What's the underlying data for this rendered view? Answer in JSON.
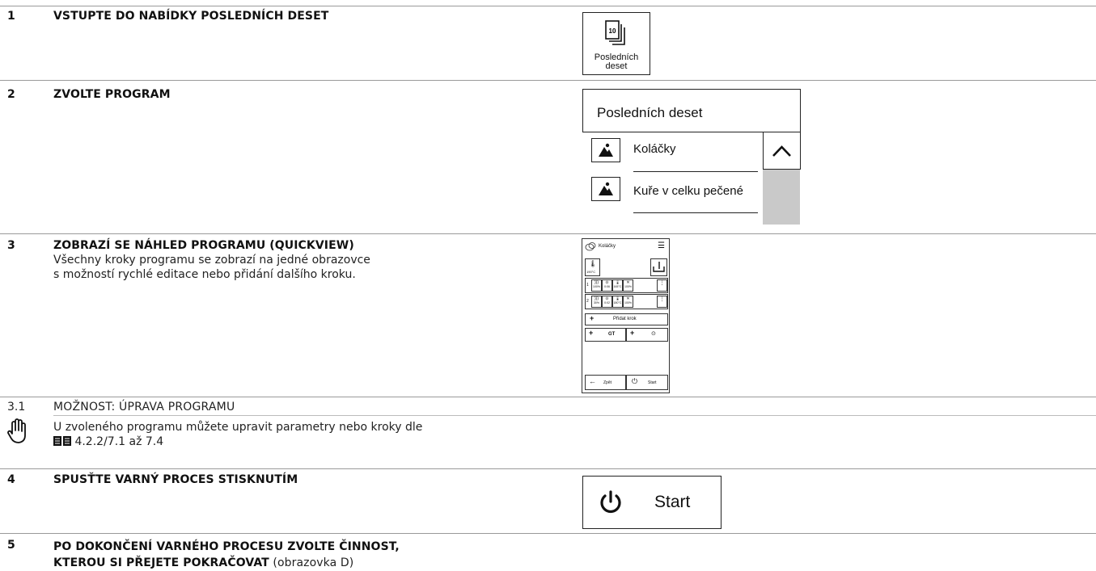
{
  "steps": [
    {
      "num": "1",
      "heading": "VSTUPTE DO NABÍDKY POSLEDNÍCH DESET"
    },
    {
      "num": "2",
      "heading": "ZVOLTE PROGRAM"
    },
    {
      "num": "3",
      "heading": "ZOBRAZÍ SE NÁHLED PROGRAMU (QUICKVIEW)",
      "text_line1": "Všechny kroky programu se zobrazí na jedné obrazovce",
      "text_line2": "s možností rychlé editace nebo přidání dalšího kroku."
    },
    {
      "num": "3.1",
      "heading": "MOŽNOST: ÚPRAVA PROGRAMU",
      "text_line1": "U zvoleného programu můžete upravit parametry nebo kroky dle",
      "ref": "4.2.2/7.1 až 7.4"
    },
    {
      "num": "4",
      "heading": "SPUSŤTE VARNÝ PROCES STISKNUTÍM"
    },
    {
      "num": "5",
      "heading_line1": "PO DOKONČENÍ VARNÉHO PROCESU ZVOLTE ČINNOST,",
      "heading_line2": "KTEROU SI PŘEJETE POKRAČOVAT",
      "suffix": " (obrazovka D)"
    }
  ],
  "last_ten_tile": {
    "icon_number": "10",
    "label_line1": "Posledních",
    "label_line2": "deset",
    "icon": "stacked-pages-icon"
  },
  "program_list": {
    "title": "Posledních deset",
    "items": [
      {
        "label": "Koláčky",
        "icon": "image-placeholder-icon"
      },
      {
        "label": "Kuře v celku pečené",
        "icon": "image-placeholder-icon"
      }
    ],
    "scroll_icon": "chevron-up-icon"
  },
  "quickview": {
    "title": "Koláčky",
    "temp": "190°C",
    "steps": [
      {
        "n": "1",
        "v1": "100%",
        "v2": "0:06",
        "v3": "165°C",
        "v4": "100%"
      },
      {
        "n": "2",
        "v1": "30%",
        "v2": "0:02",
        "v3": "180°C",
        "v4": "100%"
      }
    ],
    "add_step": "Přidat krok",
    "gt_label": "GT",
    "back": "Zpět",
    "start": "Start"
  },
  "start_button": {
    "label": "Start",
    "icon": "power-icon"
  },
  "colors": {
    "rule": "#9a9a9a",
    "scrollbar": "#c9c9c9",
    "text": "#111111"
  }
}
